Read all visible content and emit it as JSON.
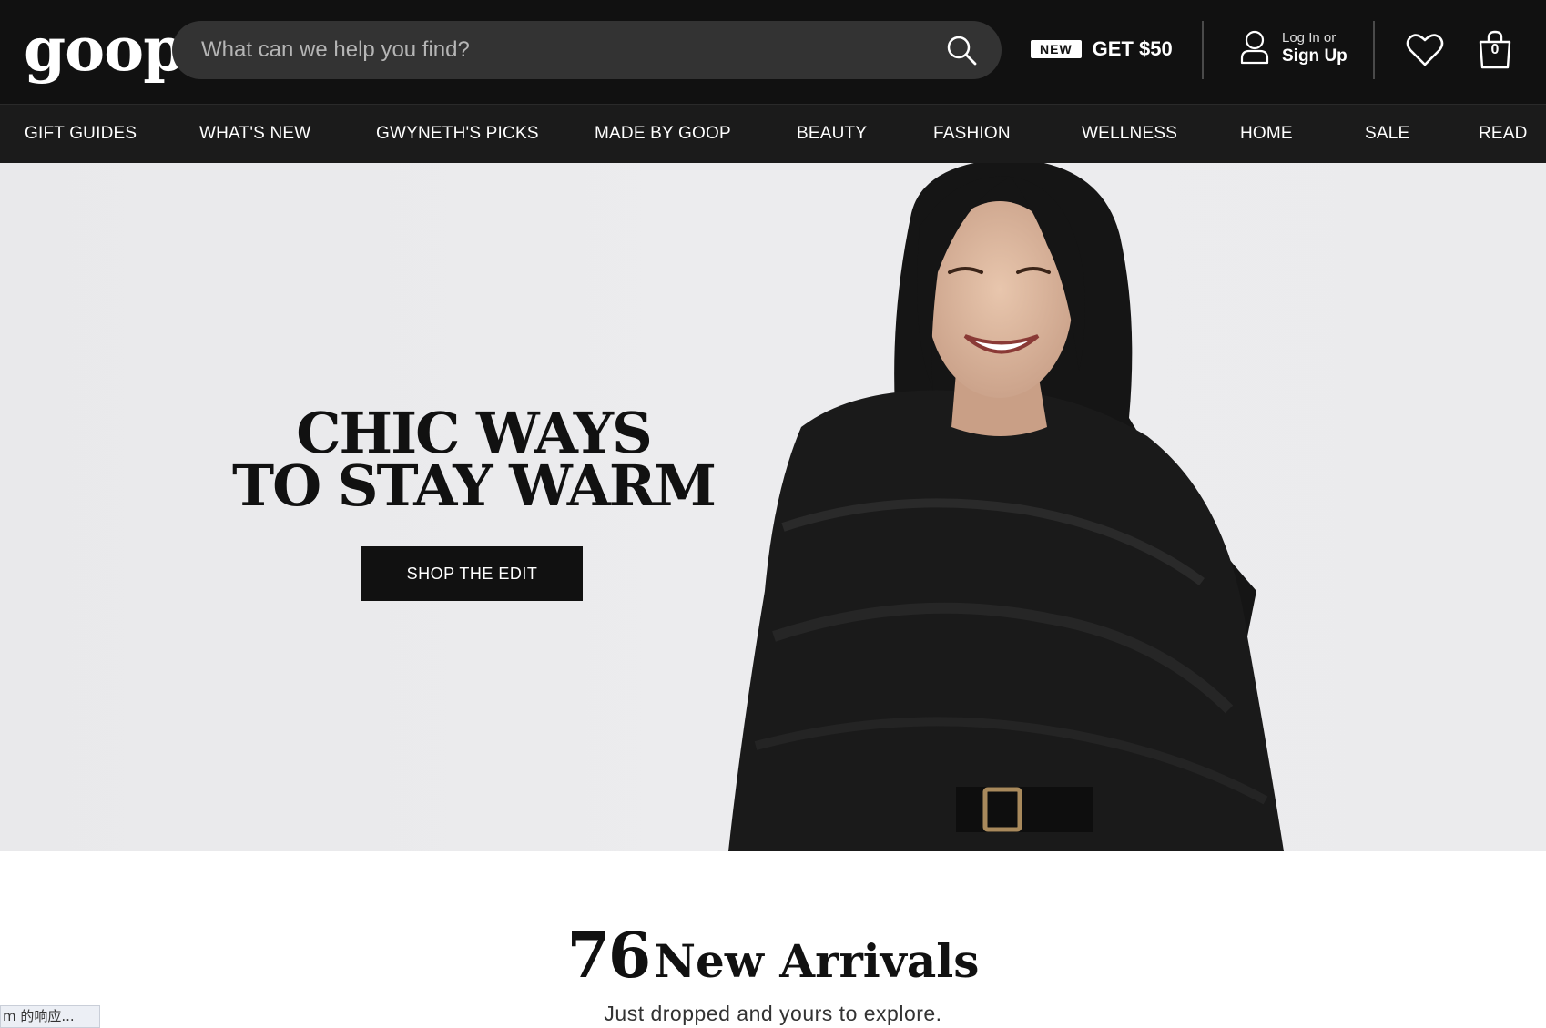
{
  "header": {
    "logo": "goop",
    "search_placeholder": "What can we help you find?",
    "promo_badge": "NEW",
    "promo_text": "GET $50",
    "account_line1": "Log In or",
    "account_line2": "Sign Up",
    "bag_count": "0"
  },
  "nav": {
    "items": [
      {
        "label": "GIFT GUIDES"
      },
      {
        "label": "WHAT'S NEW"
      },
      {
        "label": "GWYNETH'S PICKS"
      },
      {
        "label": "MADE BY GOOP"
      },
      {
        "label": "BEAUTY"
      },
      {
        "label": "FASHION"
      },
      {
        "label": "WELLNESS"
      },
      {
        "label": "HOME"
      },
      {
        "label": "SALE"
      },
      {
        "label": "READ"
      }
    ]
  },
  "hero": {
    "headline_line1": "CHIC WAYS",
    "headline_line2": "TO STAY WARM",
    "cta": "SHOP THE EDIT"
  },
  "arrivals": {
    "count": "76",
    "title": "New Arrivals",
    "subtitle": "Just dropped and yours to explore."
  },
  "status_bar": {
    "text": "m 的响应..."
  },
  "colors": {
    "header_bg": "#111111",
    "nav_bg": "#1b1b1b",
    "search_bg": "#333333",
    "hero_bg": "#ebebed",
    "cta_bg": "#111111"
  }
}
